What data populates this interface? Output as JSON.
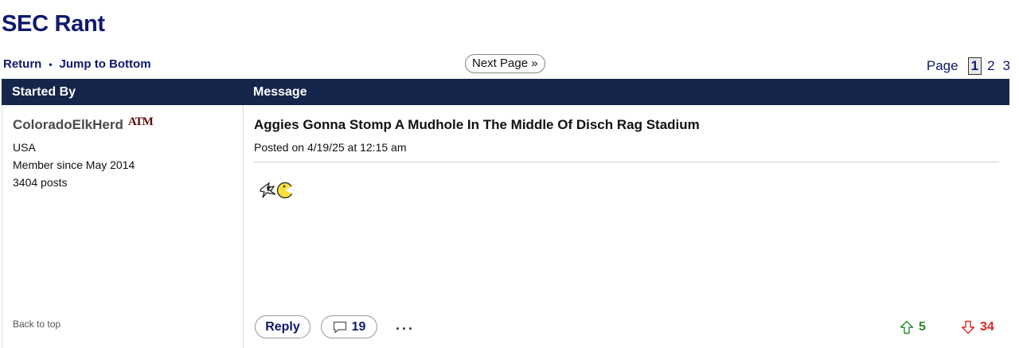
{
  "board": {
    "title": "SEC Rant"
  },
  "nav": {
    "return_label": "Return",
    "separator": "•",
    "jump_label": "Jump to Bottom",
    "next_page_label": "Next Page »"
  },
  "pager": {
    "label": "Page",
    "pages": [
      "1",
      "2",
      "3"
    ],
    "current": "1"
  },
  "table": {
    "col_started_by": "Started By",
    "col_message": "Message"
  },
  "author": {
    "name": "ColoradoElkHerd",
    "team_logo_text": "ATM",
    "location": "USA",
    "member_since": "Member since May 2014",
    "posts": "3404 posts",
    "back_to_top": "Back to top"
  },
  "post": {
    "title": "Aggies Gonna Stomp A Mudhole In The Middle Of Disch Rag Stadium",
    "posted": "Posted on 4/19/25 at 12:15 am",
    "reply_label": "Reply",
    "comment_count": "19",
    "more_label": "...",
    "upvotes": "5",
    "downvotes": "34"
  },
  "colors": {
    "brand_navy": "#0d1a6e",
    "header_bg": "#16254b",
    "upvote": "#2e8b2e",
    "downvote": "#d8281e",
    "aggie_maroon": "#5c0a0a"
  },
  "icons": {
    "team_logo": "texas-am-logo-icon",
    "emoji": "pacman-chasing-icon",
    "comment": "speech-bubble-icon",
    "upvote": "arrow-up-outline-icon",
    "downvote": "arrow-down-outline-icon"
  }
}
